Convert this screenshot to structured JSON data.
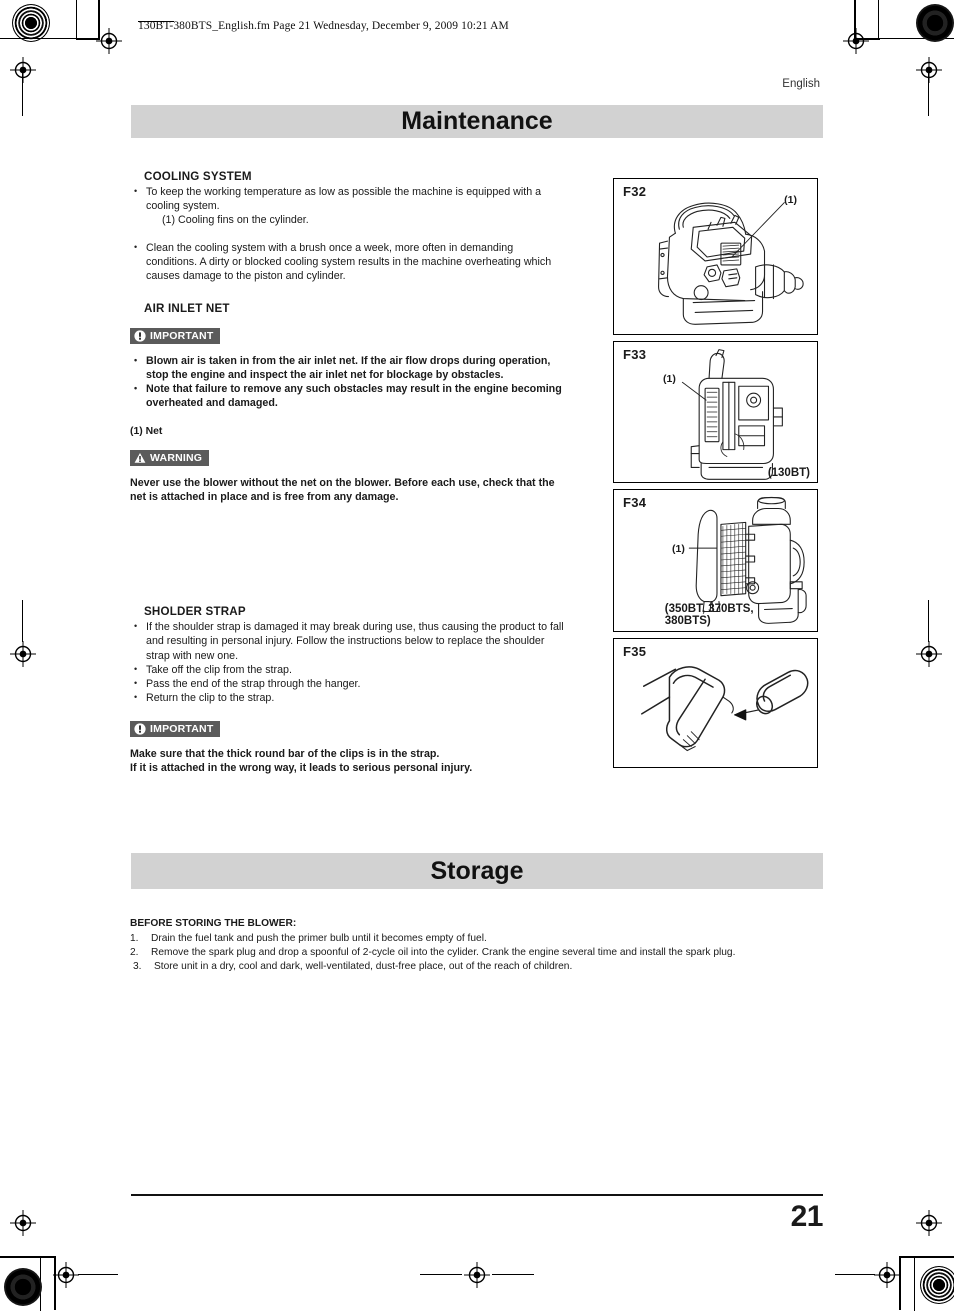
{
  "document": {
    "fm_header": "130BT-380BTS_English.fm  Page 21  Wednesday, December 9, 2009  10:21 AM",
    "language": "English",
    "page_number": "21"
  },
  "sections": [
    {
      "id": "maintenance",
      "title": "Maintenance"
    },
    {
      "id": "storage",
      "title": "Storage"
    }
  ],
  "maintenance": {
    "cooling": {
      "heading": "COOLING SYSTEM",
      "bullets_1": [
        "To keep the working temperature as low as possible the machine is equipped with a cooling system."
      ],
      "subnote": "(1) Cooling fins on the cylinder.",
      "bullets_2": [
        "Clean the cooling system with a brush once a week, more often in demanding conditions. A dirty or blocked cooling system results in the machine overheating which causes damage to the piston and cylinder."
      ]
    },
    "air_inlet": {
      "heading": "AIR INLET NET",
      "important_badge": "IMPORTANT",
      "important_icon": "exclamation-circle-icon",
      "important_bullets": [
        "Blown air is taken in from the air inlet net. If the air flow drops during operation, stop the engine and inspect the air inlet net for blockage by obstacles.",
        "Note that failure to remove any such obstacles may result in the engine becoming overheated and damaged."
      ],
      "net_label": "(1) Net",
      "warning_badge": "WARNING",
      "warning_icon": "warning-triangle-icon",
      "warning_text": "Never use the blower without the net on the blower. Before each use, check that the net is attached in place and is free from any damage."
    },
    "shoulder_strap": {
      "heading": "SHOLDER STRAP",
      "bullets": [
        "If the shoulder strap is damaged it may break during use, thus causing the product to fall and resulting in personal injury. Follow the instructions below to replace the shoulder strap with new one.",
        "Take off the clip from the strap.",
        "Pass the end of the strap through the hanger.",
        "Return the clip to the strap."
      ],
      "important_badge": "IMPORTANT",
      "important_icon": "exclamation-circle-icon",
      "important_lines": [
        "Make sure that the thick round bar of the clips is in the strap.",
        "If it is attached in the wrong way, it leads to serious personal injury."
      ]
    }
  },
  "storage": {
    "heading": "BEFORE STORING THE BLOWER:",
    "steps": [
      {
        "num": "1.",
        "text": "Drain the fuel tank and push the primer bulb until it becomes empty of fuel."
      },
      {
        "num": "2.",
        "text": "Remove the spark plug and drop a spoonful of 2-cycle oil into the cylider. Crank the engine several time and install the spark plug."
      },
      {
        "num": "3.",
        "text": "Store unit in a dry, cool and dark, well-ventilated, dust-free place, out of the reach of children."
      }
    ]
  },
  "figures": [
    {
      "id": "F32",
      "callout": "(1)",
      "model_label": "",
      "alt": "backpack blower engine assembly with cooling fins"
    },
    {
      "id": "F33",
      "callout": "(1)",
      "model_label": "(130BT)",
      "alt": "engine cooling fins detail for 130BT"
    },
    {
      "id": "F34",
      "callout": "(1)",
      "model_label": "(350BT, 370BTS, 380BTS)",
      "alt": "air inlet net on backpack blower"
    },
    {
      "id": "F35",
      "callout": "",
      "model_label": "",
      "alt": "shoulder strap clip and hanger"
    }
  ],
  "colors": {
    "band_gray": "#d2d2d2",
    "badge_gray": "#5b5b5b",
    "ink": "#1a1a1a"
  }
}
